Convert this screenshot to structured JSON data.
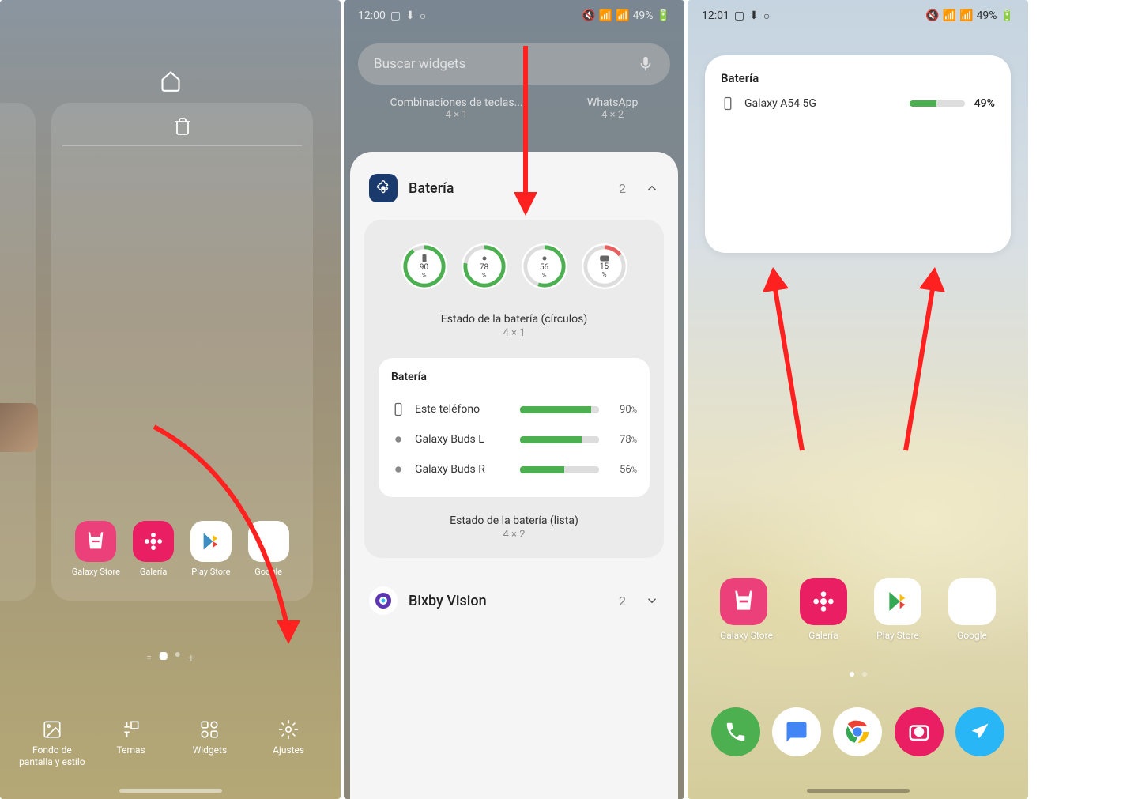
{
  "screen1": {
    "apps": [
      {
        "label": "Galaxy Store",
        "bg": "#ec407a"
      },
      {
        "label": "Galería",
        "bg": "#e91e63"
      },
      {
        "label": "Play Store",
        "bg": "#fff"
      },
      {
        "label": "Google",
        "bg": "#fff"
      }
    ],
    "bottom": [
      {
        "label": "Fondo de pantalla y estilo"
      },
      {
        "label": "Temas"
      },
      {
        "label": "Widgets"
      },
      {
        "label": "Ajustes"
      }
    ]
  },
  "screen2": {
    "status_time": "12:00",
    "status_battery": "49%",
    "search_placeholder": "Buscar widgets",
    "suggestions": [
      {
        "title": "Combinaciones de teclas...",
        "size": "4 × 1"
      },
      {
        "title": "WhatsApp",
        "size": "4 × 2"
      }
    ],
    "category": {
      "title": "Batería",
      "count": "2"
    },
    "circles": [
      {
        "pct": "90",
        "icon": "phone",
        "color": "#4CAF50"
      },
      {
        "pct": "78",
        "icon": "bud",
        "color": "#4CAF50"
      },
      {
        "pct": "56",
        "icon": "bud",
        "color": "#4CAF50"
      },
      {
        "pct": "15",
        "icon": "case",
        "color": "#e85d5d"
      }
    ],
    "circles_caption": "Estado de la batería (círculos)",
    "circles_size": "4 × 1",
    "list": {
      "title": "Batería",
      "rows": [
        {
          "name": "Este teléfono",
          "pct": 90
        },
        {
          "name": "Galaxy Buds L",
          "pct": 78
        },
        {
          "name": "Galaxy Buds R",
          "pct": 56
        }
      ]
    },
    "list_caption": "Estado de la batería (lista)",
    "list_size": "4 × 2",
    "bixby": {
      "title": "Bixby Vision",
      "count": "2"
    }
  },
  "screen3": {
    "status_time": "12:01",
    "status_battery": "49%",
    "widget": {
      "title": "Batería",
      "device": "Galaxy A54 5G",
      "pct": 49
    },
    "apps": [
      {
        "label": "Galaxy Store",
        "bg": "#ec407a"
      },
      {
        "label": "Galería",
        "bg": "#e91e63"
      },
      {
        "label": "Play Store",
        "bg": "#fff"
      },
      {
        "label": "Google",
        "bg": "#fff"
      }
    ],
    "dock": [
      {
        "bg": "#4CAF50"
      },
      {
        "bg": "#fff"
      },
      {
        "bg": "#fff"
      },
      {
        "bg": "#e91e63"
      },
      {
        "bg": "#29b6f6"
      }
    ]
  }
}
